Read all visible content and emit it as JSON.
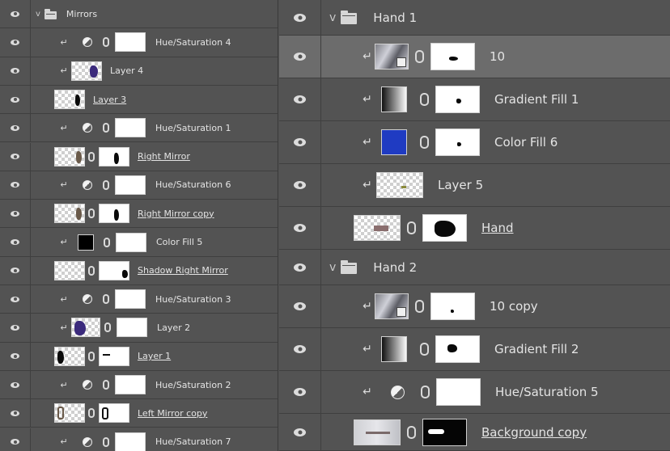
{
  "left_panel": {
    "rows": [
      {
        "type": "group",
        "label": "Mirrors"
      },
      {
        "type": "adjustment",
        "label": "Hue/Saturation 4"
      },
      {
        "type": "layer",
        "label": "Layer 4"
      },
      {
        "type": "layer",
        "label": "Layer 3"
      },
      {
        "type": "adjustment",
        "label": "Hue/Saturation 1"
      },
      {
        "type": "masked",
        "label": "Right Mirror"
      },
      {
        "type": "adjustment",
        "label": "Hue/Saturation 6"
      },
      {
        "type": "masked",
        "label": "Right Mirror copy"
      },
      {
        "type": "fill",
        "label": "Color Fill 5"
      },
      {
        "type": "masked",
        "label": "Shadow Right Mirror"
      },
      {
        "type": "adjustment",
        "label": "Hue/Saturation 3"
      },
      {
        "type": "masked",
        "label": "Layer 2"
      },
      {
        "type": "masked",
        "label": "Layer 1"
      },
      {
        "type": "adjustment",
        "label": "Hue/Saturation 2"
      },
      {
        "type": "masked",
        "label": "Left Mirror copy"
      },
      {
        "type": "adjustment",
        "label": "Hue/Saturation 7"
      }
    ]
  },
  "right_panel": {
    "rows": [
      {
        "type": "group",
        "label": "Hand 1"
      },
      {
        "type": "smart",
        "label": "10"
      },
      {
        "type": "gradient",
        "label": "Gradient Fill 1"
      },
      {
        "type": "fill",
        "label": "Color Fill 6"
      },
      {
        "type": "layer",
        "label": "Layer 5"
      },
      {
        "type": "masked",
        "label": "Hand"
      },
      {
        "type": "group",
        "label": "Hand 2"
      },
      {
        "type": "smart",
        "label": "10 copy"
      },
      {
        "type": "gradient",
        "label": "Gradient Fill 2"
      },
      {
        "type": "adjustment",
        "label": "Hue/Saturation 5"
      },
      {
        "type": "masked",
        "label": "Background copy"
      }
    ]
  },
  "glyphs": {
    "clip_arrow": "↵",
    "chevron": "v",
    "eye": "eye-icon"
  },
  "colors": {
    "panel_bg": "#535353",
    "selected_row_bg": "#6c6c6c",
    "color_fill_6": "#1f3bc2",
    "color_fill_5": "#000000"
  }
}
